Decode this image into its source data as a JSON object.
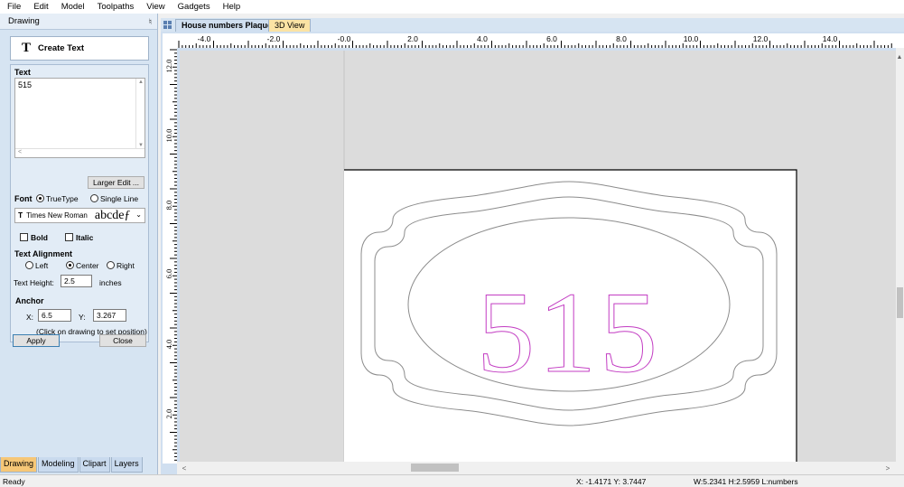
{
  "menu": [
    "File",
    "Edit",
    "Model",
    "Toolpaths",
    "View",
    "Gadgets",
    "Help"
  ],
  "panel": {
    "title": "Drawing",
    "create_text_label": "Create Text",
    "text_section": "Text",
    "text_value": "515",
    "larger_edit": "Larger Edit ...",
    "font_label": "Font",
    "font_truetype": "TrueType",
    "font_single_line": "Single Line",
    "font_name": "Times New Roman",
    "font_sample": "abcdeƒ",
    "bold": "Bold",
    "italic": "Italic",
    "alignment_section": "Text Alignment",
    "align_left": "Left",
    "align_center": "Center",
    "align_right": "Right",
    "text_height_label": "Text Height:",
    "text_height_value": "2.5",
    "text_height_unit": "inches",
    "anchor_section": "Anchor",
    "x_label": "X:",
    "x_value": "6.5",
    "y_label": "Y:",
    "y_value": "3.267",
    "anchor_hint": "(Click on drawing to set position)",
    "apply": "Apply",
    "close": "Close",
    "tabs": [
      "Drawing",
      "Modeling",
      "Clipart",
      "Layers"
    ]
  },
  "doc_tabs": [
    "House numbers Plaque",
    "3D View"
  ],
  "ruler": {
    "h_labels": [
      "-4.0",
      "-2.0",
      "-0.0",
      "2.0",
      "4.0",
      "6.0",
      "8.0",
      "10.0",
      "12.0",
      "14.0"
    ],
    "v_labels": [
      "12.0",
      "10.0",
      "8.0",
      "6.0",
      "4.0",
      "2.0"
    ]
  },
  "drawing": {
    "text": "515",
    "text_color": "#c33ec3",
    "outline_color": "#8a8a8a"
  },
  "status": {
    "ready": "Ready",
    "coords": "X: -1.4171 Y:  3.7447",
    "size": "W:5.2341  H:2.5959  L:numbers"
  }
}
